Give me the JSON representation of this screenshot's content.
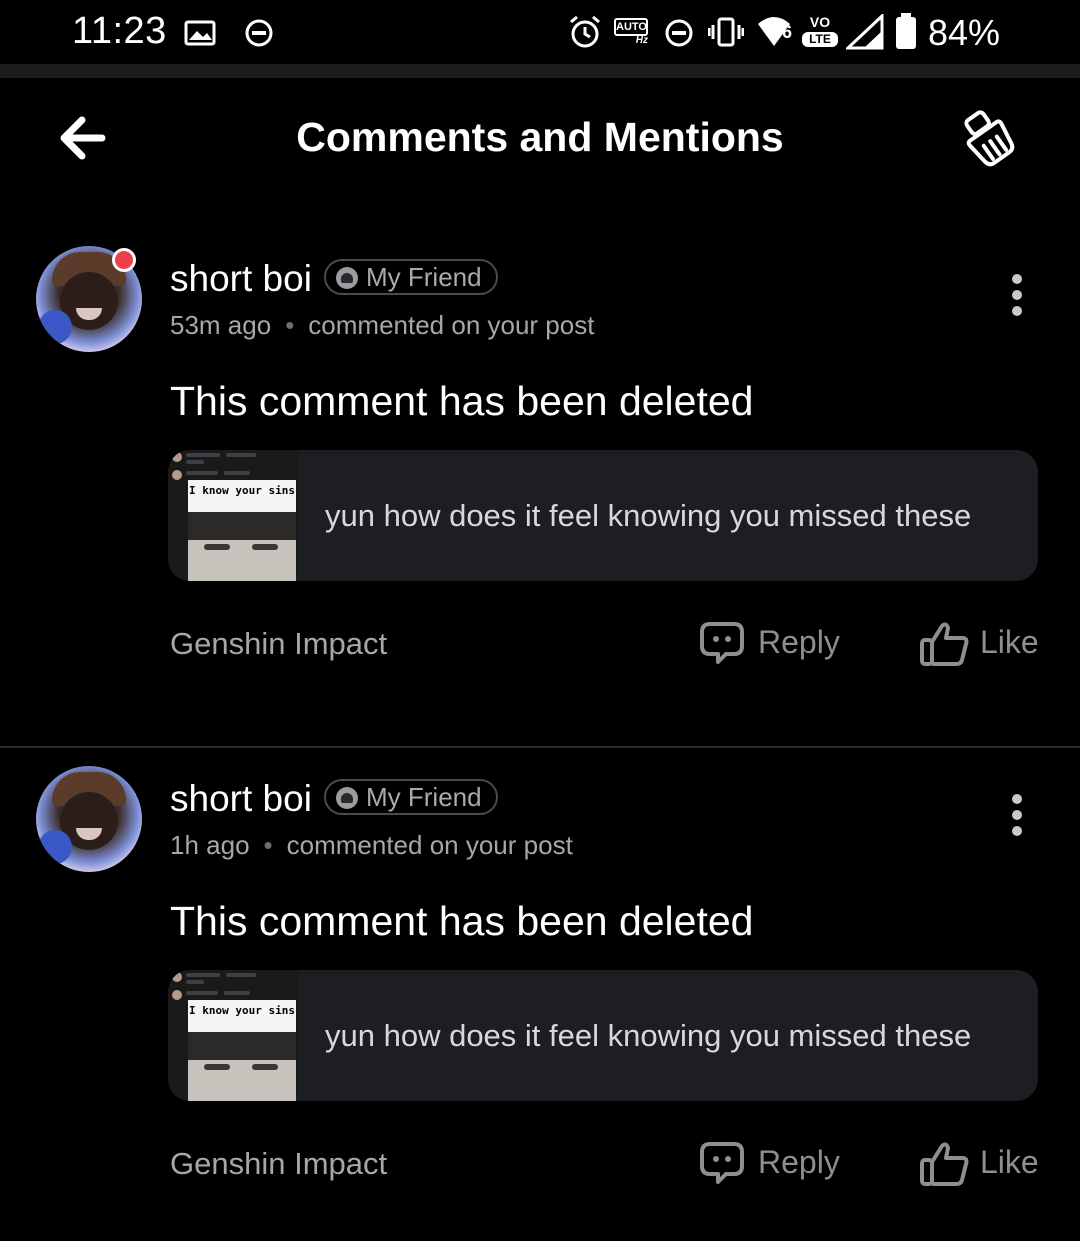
{
  "status_bar": {
    "time": "11:23",
    "battery": "84%",
    "icons": [
      "image-icon",
      "dnd-icon",
      "alarm-icon",
      "auto-hz-icon",
      "dnd-icon",
      "vibrate-icon",
      "wifi-6-icon",
      "volte-icon",
      "signal-icon",
      "battery-icon"
    ],
    "auto_label": "AUTO",
    "hz_label": "Hz",
    "vo_label": "VO",
    "lte_label": "LTE",
    "wifi_label": "6"
  },
  "header": {
    "title": "Comments and Mentions",
    "back_icon": "arrow-left-icon",
    "clear_icon": "broom-icon"
  },
  "notifications": [
    {
      "username": "short boi",
      "badge": "My Friend",
      "time": "53m ago",
      "action": "commented on your post",
      "comment": "This comment has been deleted",
      "preview_text": "yun how does it feel knowing you missed these",
      "thumb_caption": "I know your sins",
      "community": "Genshin Impact",
      "reply_label": "Reply",
      "like_label": "Like",
      "online": true
    },
    {
      "username": "short boi",
      "badge": "My Friend",
      "time": "1h ago",
      "action": "commented on your post",
      "comment": "This comment has been deleted",
      "preview_text": "yun how does it feel knowing you missed these",
      "thumb_caption": "I know your sins",
      "community": "Genshin Impact",
      "reply_label": "Reply",
      "like_label": "Like",
      "online": false
    }
  ]
}
